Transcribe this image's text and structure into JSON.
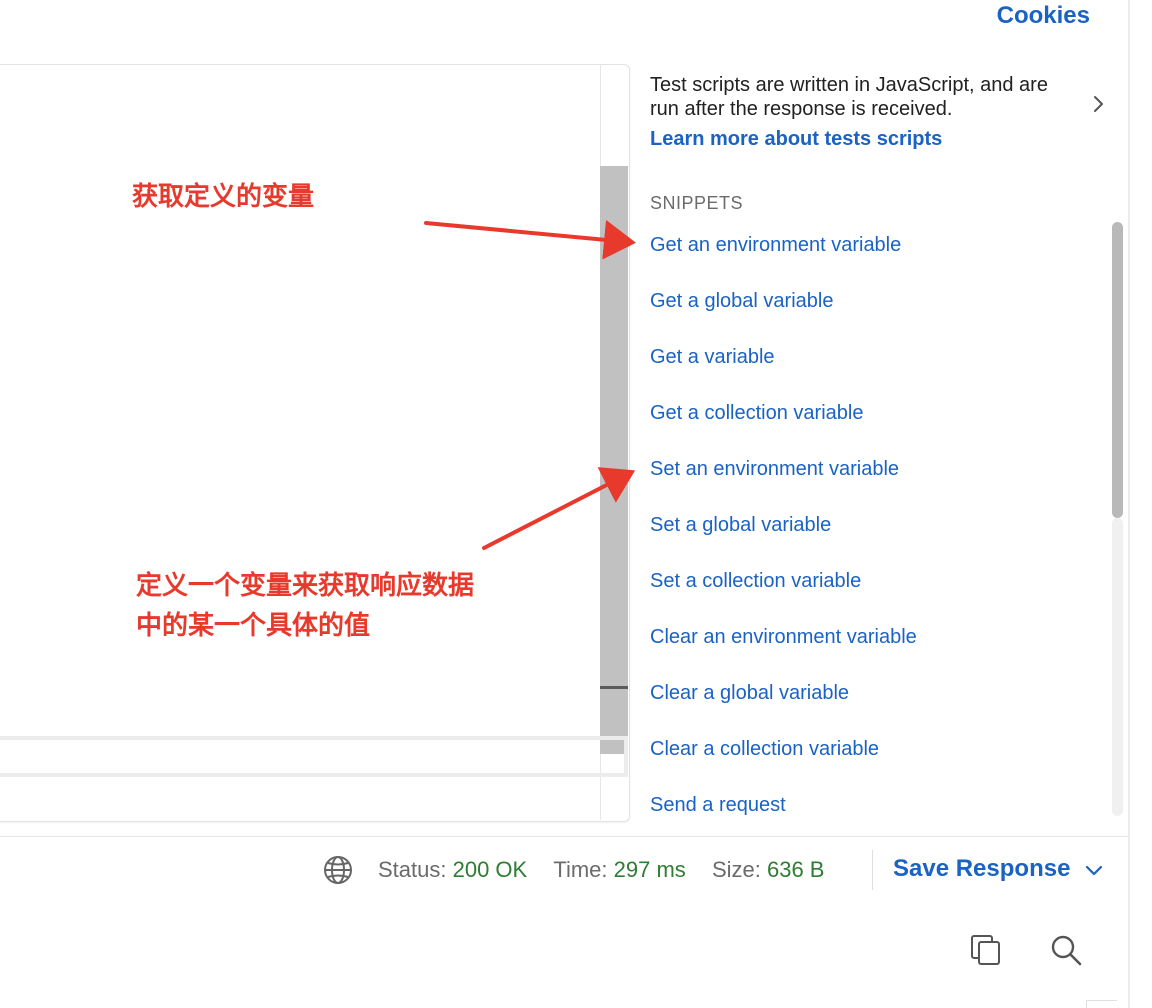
{
  "header": {
    "cookies_label": "Cookies"
  },
  "editor": {
    "annotation_top": "获取定义的变量",
    "annotation_bottom_line1": "定义一个变量来获取响应数据",
    "annotation_bottom_line2": "中的某一个具体的值"
  },
  "snippets_panel": {
    "description": "Test scripts are written in JavaScript, and are run after the response is received.",
    "learn_more": "Learn more about tests scripts",
    "header": "SNIPPETS",
    "items": [
      "Get an environment variable",
      "Get a global variable",
      "Get a variable",
      "Get a collection variable",
      "Set an environment variable",
      "Set a global variable",
      "Set a collection variable",
      "Clear an environment variable",
      "Clear a global variable",
      "Clear a collection variable",
      "Send a request"
    ]
  },
  "status_bar": {
    "status_label": "Status:",
    "status_value": "200 OK",
    "time_label": "Time:",
    "time_value": "297 ms",
    "size_label": "Size:",
    "size_value": "636 B",
    "save_response": "Save Response"
  },
  "icons": [
    "globe-icon",
    "chevron-right-icon",
    "chevron-down-icon",
    "copy-icon",
    "search-icon"
  ],
  "colors": {
    "link": "#1a62c4",
    "annotation": "#e8392d",
    "status_ok": "#2e7d32"
  }
}
